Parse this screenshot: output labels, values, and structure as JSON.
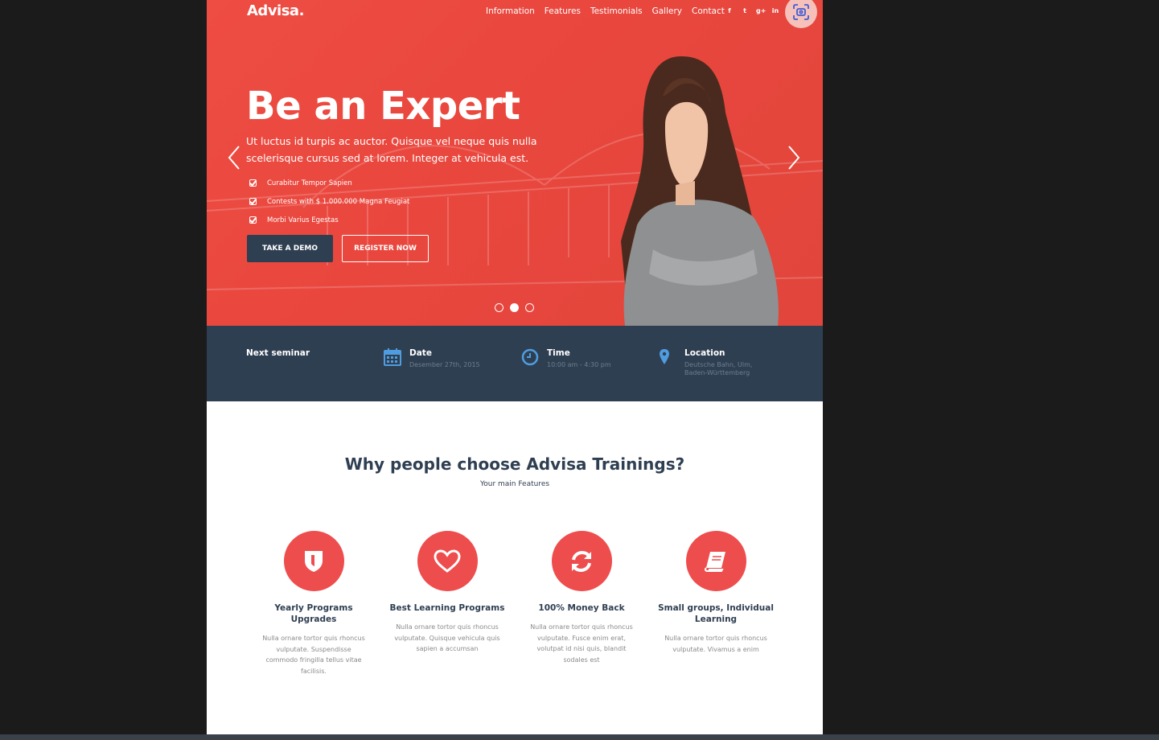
{
  "header": {
    "logo": "Advisa.",
    "nav": [
      "Information",
      "Features",
      "Testimonials",
      "Gallery",
      "Contact"
    ],
    "social": [
      "f",
      "t",
      "g+",
      "in"
    ]
  },
  "hero": {
    "title": "Be an Expert",
    "lead": "Ut luctus id turpis ac auctor. Quisque vel neque quis nulla scelerisque cursus sed at lorem. Integer at vehicula est.",
    "checklist": [
      "Curabitur Tempor Sapien",
      "Contests with $ 1.000.000 Magna Feugiat",
      "Morbi Varius Egestas"
    ],
    "demo_button": "TAKE A DEMO",
    "register_button": "REGISTER NOW",
    "slides_total": 3,
    "active_slide": 2
  },
  "seminar": {
    "title": "Next seminar",
    "date_label": "Date",
    "date_value": "Desember 27th, 2015",
    "time_label": "Time",
    "time_value": "10:00 am - 4:30 pm",
    "location_label": "Location",
    "location_value": "Deutsche Bahn, Ulm, Baden-Württemberg"
  },
  "features": {
    "heading": "Why people choose Advisa Trainings?",
    "subheading": "Your main Features",
    "items": [
      {
        "icon": "shield-icon",
        "title": "Yearly Programs Upgrades",
        "desc": "Nulla ornare tortor quis rhoncus vulputate. Suspendisse commodo fringilla tellus vitae facilisis."
      },
      {
        "icon": "heart-icon",
        "title": "Best Learning Programs",
        "desc": "Nulla ornare tortor quis rhoncus vulputate. Quisque vehicula quis sapien a accumsan"
      },
      {
        "icon": "refresh-icon",
        "title": "100% Money Back",
        "desc": "Nulla ornare tortor quis rhoncus vulputate. Fusce enim erat, volutpat id nisi quis, blandit sodales est"
      },
      {
        "icon": "book-icon",
        "title": "Small groups, Individual Learning",
        "desc": "Nulla ornare tortor quis rhoncus vulputate. Vivamus a enim"
      }
    ]
  },
  "colors": {
    "accent": "#ee4d4d",
    "navy": "#2f3f52"
  }
}
